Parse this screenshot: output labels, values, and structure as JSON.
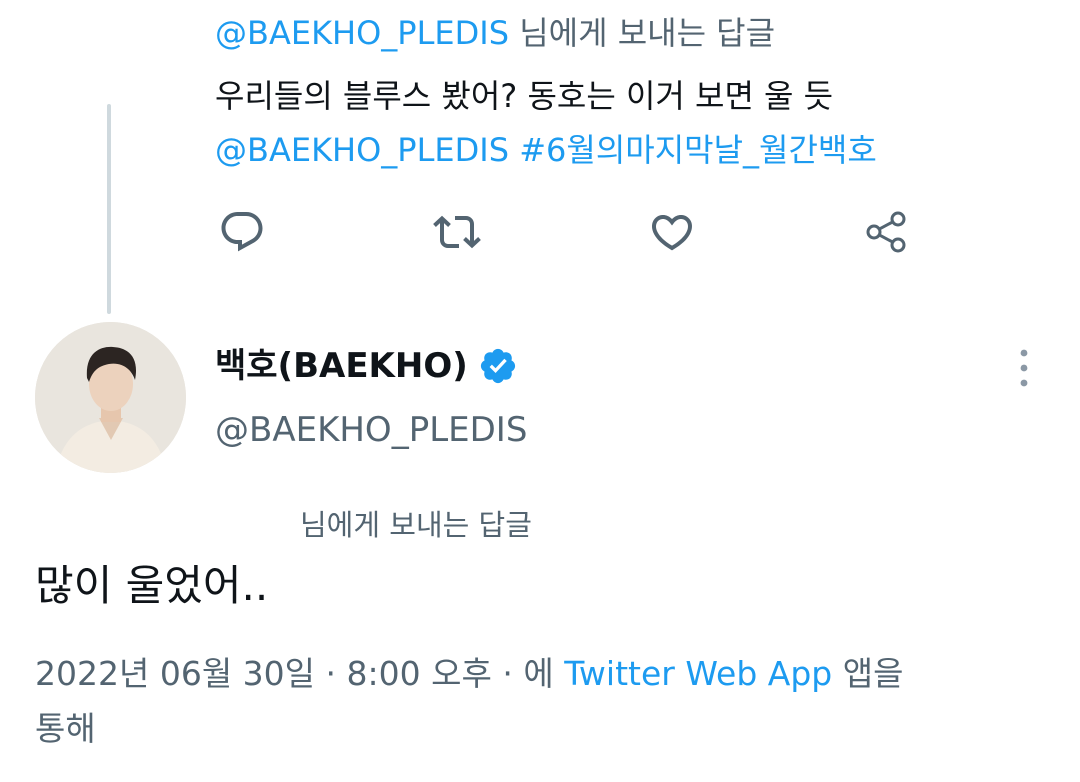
{
  "quoted_tweet": {
    "reply_handle": "@BAEKHO_PLEDIS",
    "reply_suffix": "님에게 보내는 답글",
    "text_line": "우리들의 블루스 봤어? 동호는 이거 보면 울 듯",
    "mention": "@BAEKHO_PLEDIS",
    "hashtag": "#6월의마지막날_월간백호"
  },
  "actions": {
    "icons": [
      "reply-icon",
      "retweet-icon",
      "like-icon",
      "share-icon"
    ],
    "color": "#536471"
  },
  "author": {
    "display_name": "백호(BAEKHO)",
    "handle": "@BAEKHO_PLEDIS",
    "verified": true,
    "verified_color": "#1d9bf0"
  },
  "reply_label": "님에게 보내는 답글",
  "tweet_text": "많이 울었어..",
  "meta": {
    "date": "2022년 06월 30일",
    "separator": "·",
    "time": "8:00 오후",
    "via_prefix": "에",
    "app_name": "Twitter Web App",
    "app_suffix": "앱을",
    "line2": "통해"
  },
  "colors": {
    "link": "#1d9bf0",
    "secondary_text": "#536471",
    "thread_line": "#cfd9de"
  }
}
